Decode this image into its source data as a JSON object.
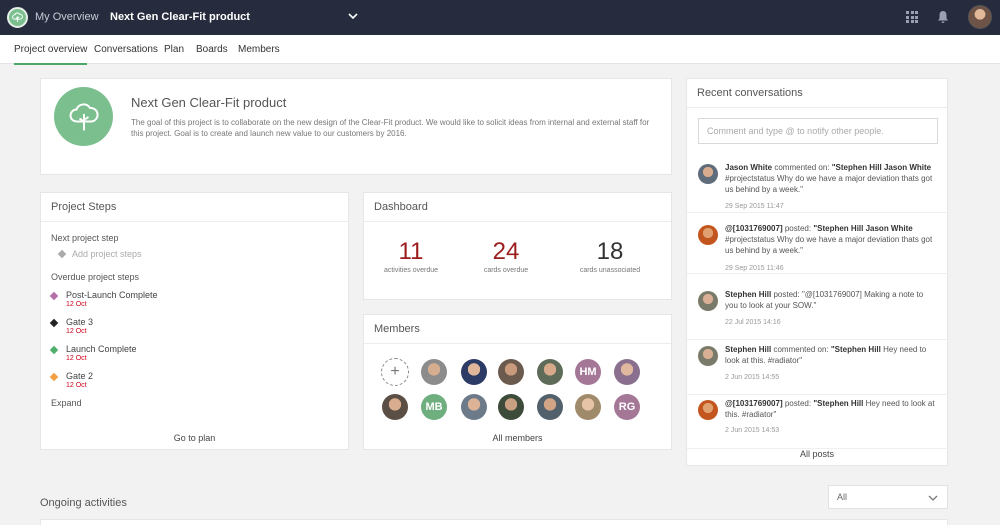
{
  "topbar": {
    "overview_label": "My Overview",
    "project_title": "Next Gen Clear-Fit product",
    "brand_color": "#7cbf8e"
  },
  "tabs": [
    {
      "label": "Project overview",
      "active": true
    },
    {
      "label": "Conversations",
      "active": false
    },
    {
      "label": "Plan",
      "active": false
    },
    {
      "label": "Boards",
      "active": false
    },
    {
      "label": "Members",
      "active": false
    }
  ],
  "project": {
    "name": "Next Gen Clear-Fit product",
    "description": "The goal of this project is to collaborate on the new design of the Clear-Fit product. We would like to solicit ideas from internal and external staff for this project. Goal is to create and launch new value to our customers by 2016."
  },
  "steps": {
    "title": "Project Steps",
    "next_label": "Next project step",
    "add_label": "Add project steps",
    "overdue_label": "Overdue project steps",
    "items": [
      {
        "name": "Post-Launch Complete",
        "date": "12 Oct",
        "color": "#b56fa8"
      },
      {
        "name": "Gate 3",
        "date": "12 Oct",
        "color": "#222222"
      },
      {
        "name": "Launch Complete",
        "date": "12 Oct",
        "color": "#4fb06e"
      },
      {
        "name": "Gate 2",
        "date": "12 Oct",
        "color": "#f0a040"
      }
    ],
    "expand_label": "Expand",
    "footer_label": "Go to plan"
  },
  "dashboard": {
    "title": "Dashboard",
    "stats": [
      {
        "value": "11",
        "label": "activities overdue"
      },
      {
        "value": "24",
        "label": "cards overdue"
      },
      {
        "value": "18",
        "label": "cards unassociated"
      }
    ]
  },
  "members": {
    "title": "Members",
    "add_label": "+",
    "initials": [
      "HM",
      "MB",
      "RG"
    ],
    "footer_label": "All members"
  },
  "conversations": {
    "title": "Recent conversations",
    "placeholder": "Comment and type @ to notify other people.",
    "items": [
      {
        "author": "Jason White",
        "action": "commented on:",
        "target": "\"Stephen Hill Jason White",
        "text": "#projectstatus Why do we have a major deviation thats got us behind by a week.\"",
        "time": "29 Sep 2015 11:47"
      },
      {
        "author": "@[1031769007]",
        "action": "posted:",
        "target": "\"Stephen Hill Jason White",
        "text": "#projectstatus Why do we have a major deviation thats got us behind by a week.\"",
        "time": "29 Sep 2015 11:46"
      },
      {
        "author": "Stephen Hill",
        "action": "posted:",
        "target": "",
        "text": "\"@[1031769007] Making a note to you to look at your SOW.\"",
        "time": "22 Jul 2015 14:16"
      },
      {
        "author": "Stephen Hill",
        "action": "commented on:",
        "target": "\"Stephen Hill",
        "text": "Hey need to look at this. #radiator\"",
        "time": "2 Jun 2015 14:55"
      },
      {
        "author": "@[1031769007]",
        "action": "posted:",
        "target": "\"Stephen Hill",
        "text": "Hey need to look at this. #radiator\"",
        "time": "2 Jun 2015 14:53"
      }
    ],
    "footer_label": "All posts"
  },
  "ongoing": {
    "title": "Ongoing activities",
    "filter_value": "All"
  }
}
